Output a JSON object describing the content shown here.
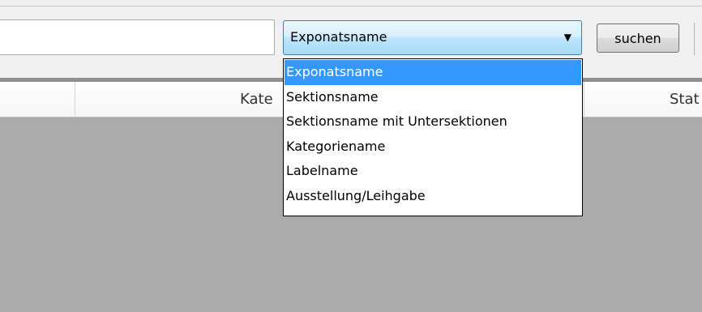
{
  "search": {
    "value": "",
    "placeholder": ""
  },
  "search_type_select": {
    "selected": "Exponatsname",
    "options": [
      "Exponatsname",
      "Sektionsname",
      "Sektionsname mit Untersektionen",
      "Kategoriename",
      "Labelname",
      "Ausstellung/Leihgabe"
    ],
    "selected_index": 0,
    "expanded": true
  },
  "search_button": {
    "label": "suchen"
  },
  "grid": {
    "columns": [
      "",
      "Kate",
      "Stat"
    ]
  },
  "colors": {
    "selection": "#3399ff",
    "combo_border": "#3c7fb1",
    "grid_body": "#ababab",
    "window_bg": "#f0f0f0"
  },
  "icons": {
    "combo_arrow": "dropdown-arrow-icon"
  }
}
